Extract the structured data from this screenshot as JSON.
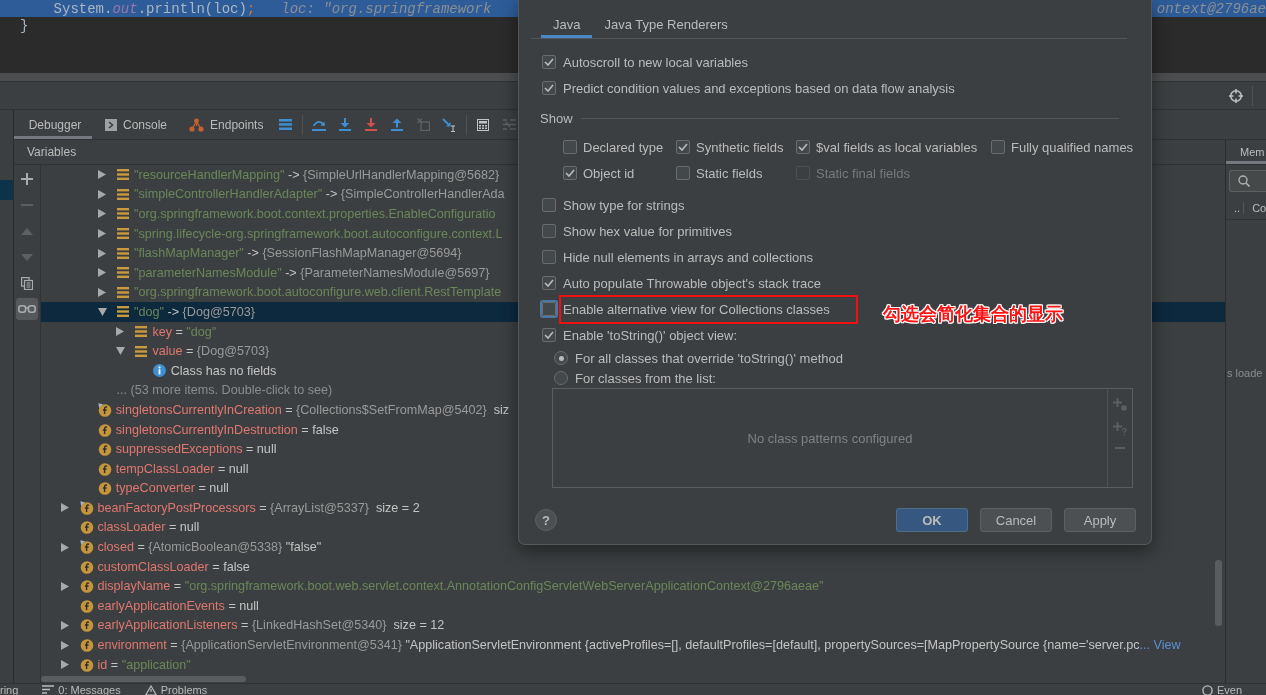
{
  "editor": {
    "lines": [
      {
        "highlighted": true,
        "segments": [
          {
            "text": "    System.",
            "kind": "text"
          },
          {
            "text": "out",
            "kind": "field"
          },
          {
            "text": ".println(loc)",
            "kind": "text"
          },
          {
            "text": ";",
            "kind": "punctuation"
          }
        ],
        "hint": "loc: \"org.springframework",
        "hint_tail": "ontext@2796ae"
      },
      {
        "highlighted": false,
        "segments": [
          {
            "text": "}",
            "kind": "text"
          }
        ]
      }
    ]
  },
  "debugger": {
    "tabs": [
      {
        "label": "Debugger",
        "kind": "text",
        "selected": true
      },
      {
        "label": "Console",
        "kind": "console",
        "selected": false
      },
      {
        "label": "Endpoints",
        "kind": "endpoints",
        "selected": false
      }
    ],
    "toolbar": [
      {
        "kind": "layout",
        "disabled": false
      },
      {
        "kind": "separator"
      },
      {
        "kind": "step_over",
        "disabled": false
      },
      {
        "kind": "step_into",
        "disabled": false
      },
      {
        "kind": "force_step_into",
        "disabled": false
      },
      {
        "kind": "step_out",
        "disabled": false
      },
      {
        "kind": "drop_frame",
        "disabled": true
      },
      {
        "kind": "run_to_cursor",
        "disabled": false
      },
      {
        "kind": "separator"
      },
      {
        "kind": "evaluate",
        "disabled": false
      },
      {
        "kind": "trace",
        "disabled": true
      }
    ]
  },
  "variables": {
    "title": "Variables",
    "side_tools": [
      {
        "kind": "add",
        "disabled": false,
        "on": false
      },
      {
        "kind": "remove",
        "disabled": true,
        "on": false
      },
      {
        "kind": "up",
        "disabled": true,
        "on": false
      },
      {
        "kind": "down",
        "disabled": true,
        "on": false
      },
      {
        "kind": "copy",
        "disabled": false,
        "on": false
      },
      {
        "kind": "glasses",
        "disabled": false,
        "on": true
      }
    ],
    "tree": [
      {
        "children": [
          {
            "children": [
              {
                "kind": "entry",
                "expanded": false,
                "selected": false,
                "segments": [
                  {
                    "text": "\"resourceHandlerMapping\"",
                    "kind": "string"
                  },
                  {
                    "text": " -> ",
                    "kind": "text"
                  },
                  {
                    "text": "{SimpleUrlHandlerMapping@5682}",
                    "kind": "ref"
                  }
                ]
              },
              {
                "kind": "entry",
                "expanded": false,
                "selected": false,
                "segments": [
                  {
                    "text": "\"simpleControllerHandlerAdapter\"",
                    "kind": "string"
                  },
                  {
                    "text": " -> ",
                    "kind": "text"
                  },
                  {
                    "text": "{SimpleControllerHandlerAda",
                    "kind": "ref"
                  }
                ]
              },
              {
                "kind": "entry",
                "expanded": false,
                "selected": false,
                "segments": [
                  {
                    "text": "\"org.springframework.boot.context.properties.EnableConfiguratio",
                    "kind": "string"
                  }
                ]
              },
              {
                "kind": "entry",
                "expanded": false,
                "selected": false,
                "segments": [
                  {
                    "text": "\"spring.lifecycle-org.springframework.boot.autoconfigure.context.L",
                    "kind": "string"
                  }
                ]
              },
              {
                "kind": "entry",
                "expanded": false,
                "selected": false,
                "segments": [
                  {
                    "text": "\"flashMapManager\"",
                    "kind": "string"
                  },
                  {
                    "text": " -> ",
                    "kind": "text"
                  },
                  {
                    "text": "{SessionFlashMapManager@5694}",
                    "kind": "ref"
                  }
                ]
              },
              {
                "kind": "entry",
                "expanded": false,
                "selected": false,
                "segments": [
                  {
                    "text": "\"parameterNamesModule\"",
                    "kind": "string"
                  },
                  {
                    "text": " -> ",
                    "kind": "text"
                  },
                  {
                    "text": "{ParameterNamesModule@5697}",
                    "kind": "ref"
                  }
                ]
              },
              {
                "kind": "entry",
                "expanded": false,
                "selected": false,
                "segments": [
                  {
                    "text": "\"org.springframework.boot.autoconfigure.web.client.RestTemplate",
                    "kind": "string"
                  }
                ]
              },
              {
                "kind": "entry",
                "expanded": true,
                "selected": true,
                "segments": [
                  {
                    "text": "\"dog\"",
                    "kind": "string"
                  },
                  {
                    "text": " -> ",
                    "kind": "text"
                  },
                  {
                    "text": "{Dog@5703}",
                    "kind": "ref"
                  }
                ],
                "children": [
                  {
                    "kind": "entry",
                    "expanded": false,
                    "selected": false,
                    "segments": [
                      {
                        "text": "key",
                        "kind": "name"
                      },
                      {
                        "text": " = ",
                        "kind": "text"
                      },
                      {
                        "text": "\"dog\"",
                        "kind": "string"
                      }
                    ]
                  },
                  {
                    "kind": "entry",
                    "expanded": true,
                    "selected": false,
                    "segments": [
                      {
                        "text": "value",
                        "kind": "name"
                      },
                      {
                        "text": " = ",
                        "kind": "text"
                      },
                      {
                        "text": "{Dog@5703}",
                        "kind": "ref"
                      }
                    ],
                    "children": [
                      {
                        "kind": "info",
                        "selected": false,
                        "segments": [
                          {
                            "text": "Class has no fields",
                            "kind": "text"
                          }
                        ]
                      }
                    ]
                  }
                ]
              },
              {
                "kind": "more",
                "selected": false,
                "segments": [
                  {
                    "text": "... (53 more items. Double-click to see)",
                    "kind": "note"
                  }
                ]
              }
            ]
          },
          {
            "kind": "field",
            "marked": true,
            "selected": false,
            "segments": [
              {
                "text": "singletonsCurrentlyInCreation",
                "kind": "name"
              },
              {
                "text": " = ",
                "kind": "text"
              },
              {
                "text": "{Collections$SetFromMap@5402}",
                "kind": "ref"
              },
              {
                "text": "  siz",
                "kind": "text"
              }
            ]
          },
          {
            "kind": "field",
            "marked": false,
            "selected": false,
            "segments": [
              {
                "text": "singletonsCurrentlyInDestruction",
                "kind": "name"
              },
              {
                "text": " = false",
                "kind": "text"
              }
            ]
          },
          {
            "kind": "field",
            "marked": false,
            "selected": false,
            "segments": [
              {
                "text": "suppressedExceptions",
                "kind": "name"
              },
              {
                "text": " = null",
                "kind": "text"
              }
            ]
          },
          {
            "kind": "field",
            "marked": false,
            "selected": false,
            "segments": [
              {
                "text": "tempClassLoader",
                "kind": "name"
              },
              {
                "text": " = null",
                "kind": "text"
              }
            ]
          },
          {
            "kind": "field",
            "marked": false,
            "selected": false,
            "segments": [
              {
                "text": "typeConverter",
                "kind": "name"
              },
              {
                "text": " = null",
                "kind": "text"
              }
            ]
          }
        ]
      },
      {
        "kind": "field",
        "marked": true,
        "expanded": false,
        "selected": false,
        "segments": [
          {
            "text": "beanFactoryPostProcessors",
            "kind": "name"
          },
          {
            "text": " = ",
            "kind": "text"
          },
          {
            "text": "{ArrayList@5337}",
            "kind": "ref"
          },
          {
            "text": "  size = 2",
            "kind": "text"
          }
        ]
      },
      {
        "kind": "field",
        "marked": false,
        "selected": false,
        "segments": [
          {
            "text": "classLoader",
            "kind": "name"
          },
          {
            "text": " = null",
            "kind": "text"
          }
        ]
      },
      {
        "kind": "field",
        "marked": true,
        "expanded": false,
        "selected": false,
        "segments": [
          {
            "text": "closed",
            "kind": "name"
          },
          {
            "text": " = ",
            "kind": "text"
          },
          {
            "text": "{AtomicBoolean@5338}",
            "kind": "ref"
          },
          {
            "text": " \"false\"",
            "kind": "text"
          }
        ]
      },
      {
        "kind": "field",
        "marked": false,
        "selected": false,
        "segments": [
          {
            "text": "customClassLoader",
            "kind": "name"
          },
          {
            "text": " = false",
            "kind": "text"
          }
        ]
      },
      {
        "kind": "field",
        "marked": false,
        "expanded": false,
        "selected": false,
        "segments": [
          {
            "text": "displayName",
            "kind": "name"
          },
          {
            "text": " = ",
            "kind": "text"
          },
          {
            "text": "\"org.springframework.boot.web.servlet.context.AnnotationConfigServletWebServerApplicationContext@2796aeae\"",
            "kind": "string"
          }
        ]
      },
      {
        "kind": "field",
        "marked": false,
        "selected": false,
        "segments": [
          {
            "text": "earlyApplicationEvents",
            "kind": "name"
          },
          {
            "text": " = null",
            "kind": "text"
          }
        ]
      },
      {
        "kind": "field",
        "marked": false,
        "expanded": false,
        "selected": false,
        "segments": [
          {
            "text": "earlyApplicationListeners",
            "kind": "name"
          },
          {
            "text": " = ",
            "kind": "text"
          },
          {
            "text": "{LinkedHashSet@5340}",
            "kind": "ref"
          },
          {
            "text": "  size = 12",
            "kind": "text"
          }
        ]
      },
      {
        "kind": "field",
        "marked": false,
        "expanded": false,
        "selected": false,
        "segments": [
          {
            "text": "environment",
            "kind": "name"
          },
          {
            "text": " = ",
            "kind": "text"
          },
          {
            "text": "{ApplicationServletEnvironment@5341}",
            "kind": "ref"
          },
          {
            "text": " \"ApplicationServletEnvironment {activeProfiles=[], defaultProfiles=[default], propertySources=[MapPropertySource {name='server.pc",
            "kind": "text"
          },
          {
            "text": "... View",
            "kind": "link"
          }
        ]
      },
      {
        "kind": "field",
        "marked": false,
        "expanded": false,
        "selected": false,
        "segments": [
          {
            "text": "id",
            "kind": "name"
          },
          {
            "text": " = ",
            "kind": "text"
          },
          {
            "text": "\"application\"",
            "kind": "string"
          }
        ]
      }
    ]
  },
  "memory_panel": {
    "tabs": [
      {
        "label": "Mem",
        "selected": true
      }
    ],
    "columns": [
      "..",
      "Co"
    ],
    "text": "s loade"
  },
  "dialog": {
    "tabs": [
      {
        "label": "Java",
        "selected": true
      },
      {
        "label": "Java Type Renderers",
        "selected": false
      }
    ],
    "options": [
      {
        "label": "Autoscroll to new local variables",
        "checked": true
      },
      {
        "label": "Predict condition values and exceptions based on data flow analysis",
        "checked": true
      }
    ],
    "show": {
      "title": "Show",
      "options": [
        {
          "label": "Declared type",
          "checked": false,
          "disabled": false
        },
        {
          "label": "Synthetic fields",
          "checked": true,
          "disabled": false
        },
        {
          "label": "$val fields as local variables",
          "checked": true,
          "disabled": false
        },
        {
          "label": "Fully qualified names",
          "checked": false,
          "disabled": false
        },
        {
          "label": "Object id",
          "checked": true,
          "disabled": false
        },
        {
          "label": "Static fields",
          "checked": false,
          "disabled": false
        },
        {
          "label": "Static final fields",
          "checked": false,
          "disabled": true
        }
      ]
    },
    "more_options": [
      {
        "label": "Show type for strings",
        "checked": false,
        "focused": false,
        "annotated": false
      },
      {
        "label": "Show hex value for primitives",
        "checked": false,
        "focused": false,
        "annotated": false
      },
      {
        "label": "Hide null elements in arrays and collections",
        "checked": false,
        "focused": false,
        "annotated": false
      },
      {
        "label": "Auto populate Throwable object's stack trace",
        "checked": true,
        "focused": false,
        "annotated": false
      },
      {
        "label": "Enable alternative view for Collections classes",
        "checked": false,
        "focused": true,
        "annotated": true
      },
      {
        "label": "Enable 'toString()' object view:",
        "checked": true,
        "focused": false,
        "annotated": false
      }
    ],
    "annotation": "勾选会简化集合的显示",
    "radios": [
      {
        "label": "For all classes that override 'toString()' method",
        "selected": true
      },
      {
        "label": "For classes from the list:",
        "selected": false
      }
    ],
    "pattern_list": {
      "empty_text": "No class patterns configured",
      "tools": [
        {
          "kind": "add_class",
          "disabled": true
        },
        {
          "kind": "add_pattern",
          "disabled": true
        },
        {
          "kind": "remove",
          "disabled": true
        }
      ]
    },
    "help": "?",
    "buttons": [
      {
        "label": "OK",
        "kind": "primary"
      },
      {
        "label": "Cancel",
        "kind": "secondary"
      },
      {
        "label": "Apply",
        "kind": "secondary"
      }
    ]
  },
  "status_bar": {
    "items": [
      {
        "kind": "text",
        "label": "ring"
      },
      {
        "kind": "messages",
        "label": "0: Messages"
      },
      {
        "kind": "problems",
        "label": "Problems"
      },
      {
        "kind": "event_log",
        "label": "Even"
      }
    ]
  }
}
